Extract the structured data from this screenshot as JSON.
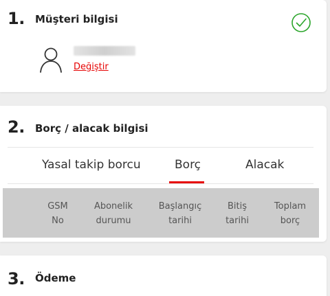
{
  "steps": [
    {
      "number": "1.",
      "title": "Müşteri bilgisi"
    },
    {
      "number": "2.",
      "title": "Borç / alacak bilgisi"
    },
    {
      "number": "3.",
      "title": "Ödeme"
    }
  ],
  "customer": {
    "change_link": "Değiştir",
    "status_icon": "check-circle-icon",
    "avatar_icon": "user-icon"
  },
  "tabs": [
    {
      "label": "Yasal takip borcu",
      "selected": false
    },
    {
      "label": "Borç",
      "selected": true
    },
    {
      "label": "Alacak",
      "selected": false
    }
  ],
  "table": {
    "columns": [
      {
        "line1": "GSM",
        "line2": "No"
      },
      {
        "line1": "Abonelik",
        "line2": "durumu"
      },
      {
        "line1": "Başlangıç",
        "line2": "tarihi"
      },
      {
        "line1": "Bitiş",
        "line2": "tarihi"
      },
      {
        "line1": "Toplam",
        "line2": "borç"
      }
    ]
  },
  "colors": {
    "accent": "#e60000",
    "success": "#2aa52a",
    "table_header_bg": "#cccccc"
  }
}
